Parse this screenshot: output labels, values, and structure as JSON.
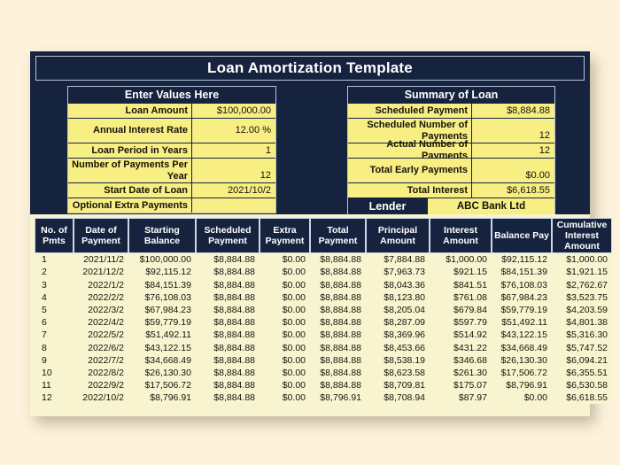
{
  "document": {
    "title": "Loan Amortization Template"
  },
  "input_panel": {
    "heading": "Enter Values Here",
    "rows": [
      {
        "label": "Loan Amount",
        "value": "$100,000.00"
      },
      {
        "label": "Annual Interest Rate",
        "value": "12.00 %"
      },
      {
        "label": "Loan Period in Years",
        "value": "1"
      },
      {
        "label": "Number of Payments Per Year",
        "value": "12"
      },
      {
        "label": "Start Date of Loan",
        "value": "2021/10/2"
      },
      {
        "label": "Optional Extra Payments",
        "value": ""
      }
    ]
  },
  "summary_panel": {
    "heading": "Summary of Loan",
    "rows": [
      {
        "label": "Scheduled Payment",
        "value": "$8,884.88"
      },
      {
        "label": "Scheduled Number of Payments",
        "value": "12"
      },
      {
        "label": "Actual Number of Payments",
        "value": "12"
      },
      {
        "label": "Total Early Payments",
        "value": "$0.00"
      },
      {
        "label": "Total Interest",
        "value": "$6,618.55"
      }
    ],
    "lender_label": "Lender",
    "lender_value": "ABC Bank Ltd"
  },
  "table": {
    "columns": [
      "No. of Pmts",
      "Date of Payment",
      "Starting Balance",
      "Scheduled Payment",
      "Extra Payment",
      "Total Payment",
      "Principal Amount",
      "Interest Amount",
      "Balance Pay",
      "Cumulative Interest Amount"
    ],
    "rows": [
      [
        "1",
        "2021/11/2",
        "$100,000.00",
        "$8,884.88",
        "$0.00",
        "$8,884.88",
        "$7,884.88",
        "$1,000.00",
        "$92,115.12",
        "$1,000.00"
      ],
      [
        "2",
        "2021/12/2",
        "$92,115.12",
        "$8,884.88",
        "$0.00",
        "$8,884.88",
        "$7,963.73",
        "$921.15",
        "$84,151.39",
        "$1,921.15"
      ],
      [
        "3",
        "2022/1/2",
        "$84,151.39",
        "$8,884.88",
        "$0.00",
        "$8,884.88",
        "$8,043.36",
        "$841.51",
        "$76,108.03",
        "$2,762.67"
      ],
      [
        "4",
        "2022/2/2",
        "$76,108.03",
        "$8,884.88",
        "$0.00",
        "$8,884.88",
        "$8,123.80",
        "$761.08",
        "$67,984.23",
        "$3,523.75"
      ],
      [
        "5",
        "2022/3/2",
        "$67,984.23",
        "$8,884.88",
        "$0.00",
        "$8,884.88",
        "$8,205.04",
        "$679.84",
        "$59,779.19",
        "$4,203.59"
      ],
      [
        "6",
        "2022/4/2",
        "$59,779.19",
        "$8,884.88",
        "$0.00",
        "$8,884.88",
        "$8,287.09",
        "$597.79",
        "$51,492.11",
        "$4,801.38"
      ],
      [
        "7",
        "2022/5/2",
        "$51,492.11",
        "$8,884.88",
        "$0.00",
        "$8,884.88",
        "$8,369.96",
        "$514.92",
        "$43,122.15",
        "$5,316.30"
      ],
      [
        "8",
        "2022/6/2",
        "$43,122.15",
        "$8,884.88",
        "$0.00",
        "$8,884.88",
        "$8,453.66",
        "$431.22",
        "$34,668.49",
        "$5,747.52"
      ],
      [
        "9",
        "2022/7/2",
        "$34,668.49",
        "$8,884.88",
        "$0.00",
        "$8,884.88",
        "$8,538.19",
        "$346.68",
        "$26,130.30",
        "$6,094.21"
      ],
      [
        "10",
        "2022/8/2",
        "$26,130.30",
        "$8,884.88",
        "$0.00",
        "$8,884.88",
        "$8,623.58",
        "$261.30",
        "$17,506.72",
        "$6,355.51"
      ],
      [
        "11",
        "2022/9/2",
        "$17,506.72",
        "$8,884.88",
        "$0.00",
        "$8,884.88",
        "$8,709.81",
        "$175.07",
        "$8,796.91",
        "$6,530.58"
      ],
      [
        "12",
        "2022/10/2",
        "$8,796.91",
        "$8,884.88",
        "$0.00",
        "$8,796.91",
        "$8,708.94",
        "$87.97",
        "$0.00",
        "$6,618.55"
      ]
    ]
  },
  "colors": {
    "navy": "#16233f",
    "input_yellow": "#f7ee84",
    "table_body": "#f9f4d0",
    "page_background": "#fdf2dc"
  }
}
